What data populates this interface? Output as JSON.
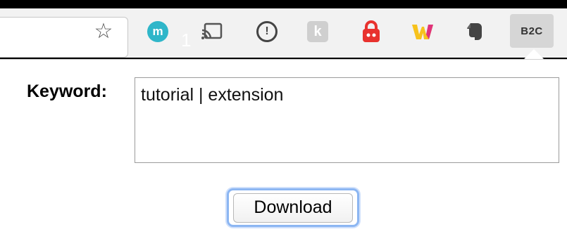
{
  "toolbar": {
    "bookmark_icon": "star-icon",
    "extensions": [
      {
        "name": "m",
        "icon": "mercury-m-icon",
        "badge": "1"
      },
      {
        "name": "cast",
        "icon": "cast-icon"
      },
      {
        "name": "1password",
        "icon": "1password-icon",
        "glyph": "!"
      },
      {
        "name": "k",
        "icon": "k-extension-icon",
        "glyph": "k"
      },
      {
        "name": "lock",
        "icon": "red-lock-icon"
      },
      {
        "name": "w",
        "icon": "w-extension-icon",
        "glyph": "W"
      },
      {
        "name": "evernote",
        "icon": "evernote-elephant-icon"
      },
      {
        "name": "b2c",
        "icon": "b2c-extension-icon",
        "label": "B2C"
      }
    ]
  },
  "popup": {
    "keyword_label": "Keyword:",
    "keyword_value": "tutorial | extension",
    "download_label": "Download"
  },
  "colors": {
    "accent_focus": "#8cb6f2",
    "m_icon": "#2fb6c9",
    "lock_red": "#e8322e"
  }
}
